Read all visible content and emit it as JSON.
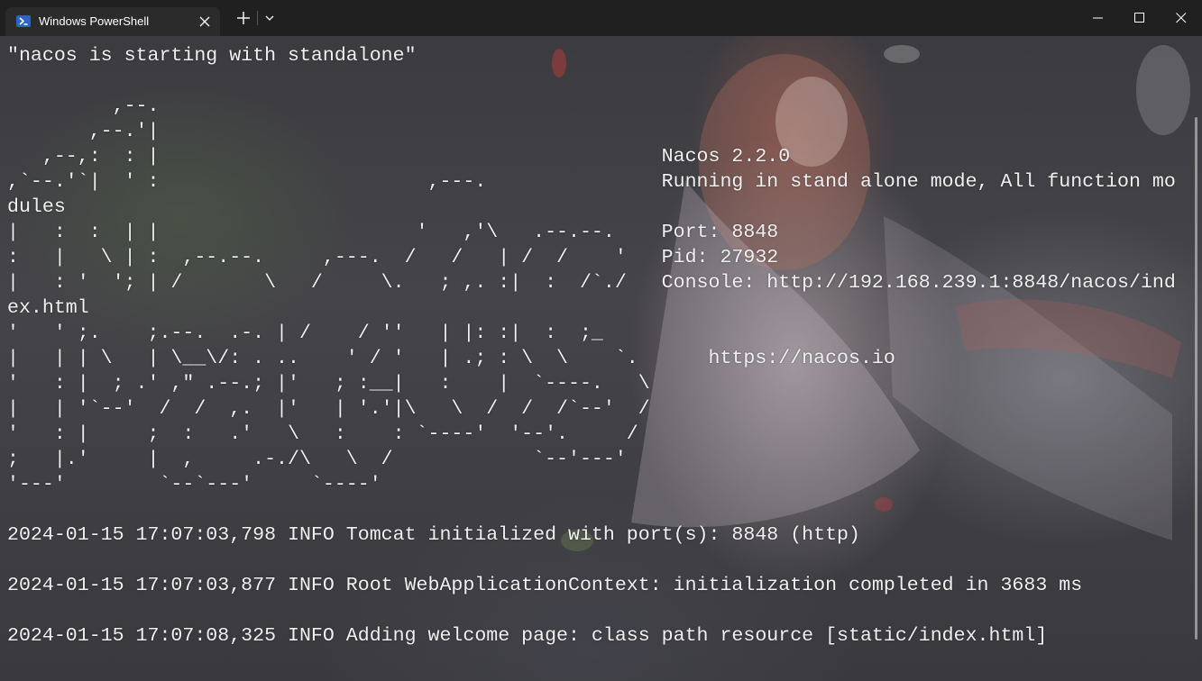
{
  "window": {
    "tab_title": "Windows PowerShell",
    "new_tab_symbol": "+",
    "icons": {
      "tab": "powershell-icon",
      "close_tab": "close-icon",
      "new_tab": "plus-icon",
      "dropdown": "chevron-down-icon",
      "minimize": "minimize-icon",
      "maximize": "maximize-icon",
      "close_window": "close-icon"
    },
    "colors": {
      "titlebar": "#202020",
      "tab": "#2b2b2b",
      "text": "#f0f0f0",
      "icon_blue": "#2d63c8"
    }
  },
  "terminal": {
    "lines": [
      "\"nacos is starting with standalone\"",
      "",
      "         ,--.",
      "       ,--.'|",
      "   ,--,:  : |                                           Nacos 2.2.0",
      ",`--.'`|  ' :                       ,---.               Running in stand alone mode, All function mo",
      "dules",
      "|   :  :  | |                      '   ,'\\   .--.--.    Port: 8848",
      ":   |   \\ | :  ,--.--.     ,---.  /   /   | /  /    '   Pid: 27932",
      "|   : '  '; | /       \\   /     \\.   ; ,. :|  :  /`./   Console: http://192.168.239.1:8848/nacos/ind",
      "ex.html",
      "'   ' ;.    ;.--.  .-. | /    / ''   | |: :|  :  ;_",
      "|   | | \\   | \\__\\/: . ..    ' / '   | .; : \\  \\    `.      https://nacos.io",
      "'   : |  ; .' ,\" .--.; |'   ; :__|   :    |  `----.   \\",
      "|   | '`--'  /  /  ,.  |'   | '.'|\\   \\  /  /  /`--'  /",
      "'   : |     ;  :   .'   \\   :    : `----'  '--'.     /",
      ";   |.'     |  ,     .-./\\   \\  /            `--'---'",
      "'---'        `--`---'     `----'",
      "",
      "2024-01-15 17:07:03,798 INFO Tomcat initialized with port(s): 8848 (http)",
      "",
      "2024-01-15 17:07:03,877 INFO Root WebApplicationContext: initialization completed in 3683 ms",
      "",
      "2024-01-15 17:07:08,325 INFO Adding welcome page: class path resource [static/index.html]"
    ]
  }
}
